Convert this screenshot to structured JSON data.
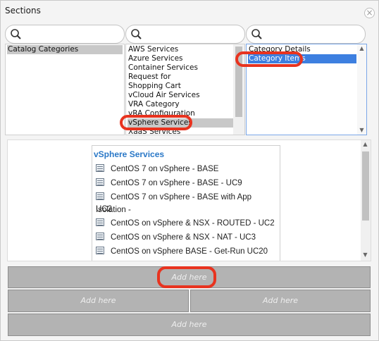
{
  "dialog": {
    "title": "Sections",
    "close_symbol": "×"
  },
  "search": {
    "placeholder_1": "",
    "placeholder_2": "",
    "placeholder_3": ""
  },
  "list1": {
    "items": [
      "Catalog Categories"
    ]
  },
  "list2": {
    "items": [
      "AWS Services",
      "Azure Services",
      "Container Services",
      "Request for",
      "Shopping Cart",
      "vCloud Air Services",
      "VRA Category",
      "vRA Configuration",
      "vSphere Services",
      "XaaS Services"
    ],
    "selected": "vSphere Services"
  },
  "list3": {
    "items": [
      "Category Details",
      "Category Items"
    ],
    "selected": "Category Items"
  },
  "card": {
    "title": "vSphere Services",
    "items": [
      "CentOS 7 on vSphere - BASE",
      "CentOS 7 on vSphere - BASE - UC9",
      "CentOS 7 on vSphere - BASE with App Isolation -",
      "UC2",
      "CentOS on vSphere & NSX - ROUTED - UC2",
      "CentOS on vSphere & NSX - NAT - UC3",
      "CentOS on vSphere BASE - Get-Run UC20"
    ]
  },
  "dropzones": {
    "label": "Add here"
  },
  "colors": {
    "accent_blue": "#3d7fe0",
    "highlight_red": "#e8331f",
    "link_blue": "#2a78c7",
    "dropzone_gray": "#b3b3b3"
  }
}
